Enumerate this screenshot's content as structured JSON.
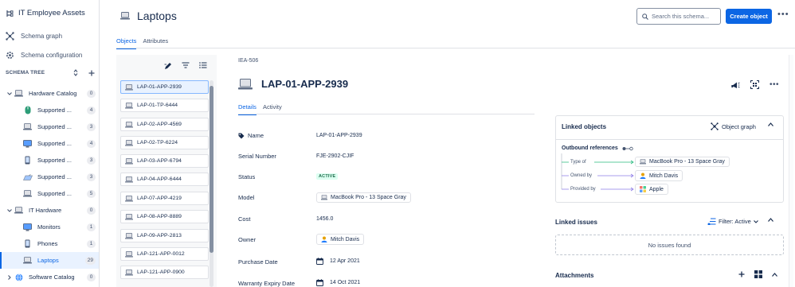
{
  "sidebar": {
    "app_title": "IT Employee Assets",
    "nav": [
      {
        "label": "Schema graph",
        "icon": "schema-graph-icon"
      },
      {
        "label": "Schema configuration",
        "icon": "gear-icon"
      }
    ],
    "tree_title": "SCHEMA TREE",
    "tree": [
      {
        "label": "Hardware Catalog",
        "count": "0",
        "level": 0,
        "expanded": true,
        "icon": "laptop-icon"
      },
      {
        "label": "Supported ...",
        "count": "4",
        "level": 1,
        "icon": "mouse-icon"
      },
      {
        "label": "Supported ...",
        "count": "3",
        "level": 1,
        "icon": "laptop-icon"
      },
      {
        "label": "Supported ...",
        "count": "4",
        "level": 1,
        "icon": "monitor-icon"
      },
      {
        "label": "Supported ...",
        "count": "3",
        "level": 1,
        "icon": "phone-icon"
      },
      {
        "label": "Supported ...",
        "count": "3",
        "level": 1,
        "icon": "keyboard-icon"
      },
      {
        "label": "Supported ...",
        "count": "5",
        "level": 1,
        "icon": "laptop-icon"
      },
      {
        "label": "IT Hardware",
        "count": "0",
        "level": 0,
        "expanded": true,
        "icon": "laptop-icon"
      },
      {
        "label": "Monitors",
        "count": "1",
        "level": 1,
        "icon": "monitor-icon"
      },
      {
        "label": "Phones",
        "count": "1",
        "level": 1,
        "icon": "phone-icon"
      },
      {
        "label": "Laptops",
        "count": "29",
        "level": 1,
        "icon": "laptop-icon",
        "selected": true
      },
      {
        "label": "Software Catalog",
        "count": "0",
        "level": 0,
        "expanded": false,
        "icon": "globe-icon"
      }
    ]
  },
  "header": {
    "title": "Laptops",
    "search_placeholder": "Search this schema...",
    "create_label": "Create object",
    "more": "•••"
  },
  "tabs": [
    {
      "label": "Objects",
      "active": true
    },
    {
      "label": "Attributes",
      "active": false
    }
  ],
  "objects": [
    "LAP-01-APP-2939",
    "LAP-01-TP-6444",
    "LAP-02-APP-4569",
    "LAP-02-TP-6224",
    "LAP-03-APP-6794",
    "LAP-04-APP-6444",
    "LAP-07-APP-4219",
    "LAP-08-APP-8889",
    "LAP-09-APP-2813",
    "LAP-121-APP-0012",
    "LAP-121-APP-0900"
  ],
  "detail": {
    "key": "IEA-506",
    "title": "LAP-01-APP-2939",
    "tabs": [
      {
        "label": "Details",
        "active": true
      },
      {
        "label": "Activity",
        "active": false
      }
    ],
    "attributes": [
      {
        "label": "Name",
        "value": "LAP-01-APP-2939",
        "kind": "text"
      },
      {
        "label": "Serial Number",
        "value": "FJE-2902-CJIF",
        "kind": "text"
      },
      {
        "label": "Status",
        "value": "ACTIVE",
        "kind": "lozenge"
      },
      {
        "label": "Model",
        "value": "MacBook Pro - 13 Space Gray",
        "kind": "chip"
      },
      {
        "label": "Cost",
        "value": "1456.0",
        "kind": "text"
      },
      {
        "label": "Owner",
        "value": "Mitch Davis",
        "kind": "chip-user"
      },
      {
        "label": "Purchase Date",
        "value": "12 Apr 2021",
        "kind": "date"
      },
      {
        "label": "Warranty Expiry Date",
        "value": "14 Oct 2021",
        "kind": "date"
      }
    ]
  },
  "linked_objects": {
    "title": "Linked objects",
    "graph_label": "Object graph",
    "outbound_label": "Outbound references",
    "refs": [
      {
        "rel": "Type of",
        "target": "MacBook Pro - 13 Space Gray",
        "color": "#2abb7f",
        "icon": "laptop-icon"
      },
      {
        "rel": "Owned by",
        "target": "Mitch Davis",
        "color": "#8f7ee7",
        "icon": "user-icon"
      },
      {
        "rel": "Provided by",
        "target": "Apple",
        "color": "#8f7ee7",
        "icon": "vendor-icon"
      }
    ]
  },
  "linked_issues": {
    "title": "Linked issues",
    "filter_label": "Filter: Active",
    "empty": "No issues found"
  },
  "attachments": {
    "title": "Attachments"
  },
  "colors": {
    "accent": "#0c66e4",
    "success_bg": "#dcfff1",
    "success_text": "#216e4e"
  }
}
